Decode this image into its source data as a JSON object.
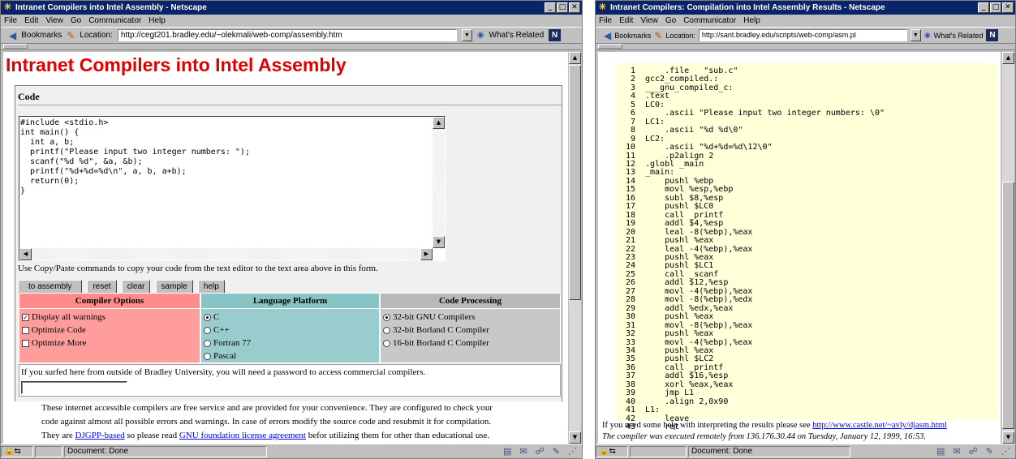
{
  "window1": {
    "title": "Intranet Compilers into Intel Assembly - Netscape",
    "menu": [
      "File",
      "Edit",
      "View",
      "Go",
      "Communicator",
      "Help"
    ],
    "toolbar": {
      "bookmarks": "Bookmarks",
      "location_label": "Location:",
      "url": "http://cegt201.bradley.edu/~olekmali/web-comp/assembly.htm",
      "whats_related": "What's Related",
      "n_logo": "N"
    },
    "page": {
      "heading": "Intranet Compilers into Intel Assembly",
      "code_label": "Code",
      "code_text": "#include <stdio.h>\nint main() {\n  int a, b;\n  printf(\"Please input two integer numbers: \");\n  scanf(\"%d %d\", &a, &b);\n  printf(\"%d+%d=%d\\n\", a, b, a+b);\n  return(0);\n}",
      "instructions": "Use Copy/Paste commands to copy your code from the text editor to the text area above in this form.",
      "buttons": [
        "to assembly",
        "reset",
        "clear",
        "sample",
        "help"
      ],
      "sections": {
        "compiler_options": {
          "header": "Compiler Options",
          "color": "#ff9c9c",
          "items": [
            {
              "label": "Display all warnings",
              "checked": true
            },
            {
              "label": "Optimize Code",
              "checked": false
            },
            {
              "label": "Optimize More",
              "checked": false
            }
          ]
        },
        "language_platform": {
          "header": "Language Platform",
          "color": "#99cccc",
          "items": [
            {
              "label": "C",
              "checked": true
            },
            {
              "label": "C++",
              "checked": false
            },
            {
              "label": "Fortran 77",
              "checked": false
            },
            {
              "label": "Pascal",
              "checked": false
            }
          ]
        },
        "code_processing": {
          "header": "Code Processing",
          "color": "#c0c0c0",
          "items": [
            {
              "label": "32-bit GNU Compilers",
              "checked": true
            },
            {
              "label": "32-bit Borland C Compiler",
              "checked": false
            },
            {
              "label": "16-bit Borland C Compiler",
              "checked": false
            }
          ]
        }
      },
      "password_note": "If you surfed here from outside of Bradley University, you will need a password to access commercial compilers.",
      "bottom_text_1": "These internet accessible compilers are free service and are provided for your convenience. They are configured to check your",
      "bottom_text_2": "code against almost all possible errors and warnings. In case of errors modify the source code and resubmit it for compilation.",
      "bottom_text_3a": "They are ",
      "bottom_link_1": "DJGPP-based",
      "bottom_text_3b": " so please read ",
      "bottom_link_2": "GNU foundation license agreement",
      "bottom_text_3c": " befor utilizing them for other than educational use."
    },
    "status": "Document: Done"
  },
  "window2": {
    "title": "Intranet Compilers: Compilation into Intel Assembly Results - Netscape",
    "menu": [
      "File",
      "Edit",
      "View",
      "Go",
      "Communicator",
      "Help"
    ],
    "toolbar": {
      "bookmarks": "Bookmarks",
      "location_label": "Location:",
      "url": "http://sant.bradley.edu/scripts/web-comp/asm.pl",
      "whats_related": "What's Related",
      "n_logo": "N"
    },
    "asm_lines": [
      "    .file   \"sub.c\"",
      "gcc2_compiled.:",
      "___gnu_compiled_c:",
      ".text",
      "LC0:",
      "    .ascii \"Please input two integer numbers: \\0\"",
      "LC1:",
      "    .ascii \"%d %d\\0\"",
      "LC2:",
      "    .ascii \"%d+%d=%d\\12\\0\"",
      "    .p2align 2",
      ".globl _main",
      "_main:",
      "    pushl %ebp",
      "    movl %esp,%ebp",
      "    subl $8,%esp",
      "    pushl $LC0",
      "    call _printf",
      "    addl $4,%esp",
      "    leal -8(%ebp),%eax",
      "    pushl %eax",
      "    leal -4(%ebp),%eax",
      "    pushl %eax",
      "    pushl $LC1",
      "    call _scanf",
      "    addl $12,%esp",
      "    movl -4(%ebp),%eax",
      "    movl -8(%ebp),%edx",
      "    addl %edx,%eax",
      "    pushl %eax",
      "    movl -8(%ebp),%eax",
      "    pushl %eax",
      "    movl -4(%ebp),%eax",
      "    pushl %eax",
      "    pushl $LC2",
      "    call _printf",
      "    addl $16,%esp",
      "    xorl %eax,%eax",
      "    jmp L1",
      "    .align 2,0x90",
      "L1:",
      "    leave",
      "    ret"
    ],
    "help_text": "If you need some help with interpreting the results please see ",
    "help_link": "http://www.castle.net/~avly/djasm.html",
    "exec_note": "The compiler was executed remotely from 136.176.30.44 on Tuesday, January 12, 1999, 16:53.",
    "status": "Document: Done"
  }
}
